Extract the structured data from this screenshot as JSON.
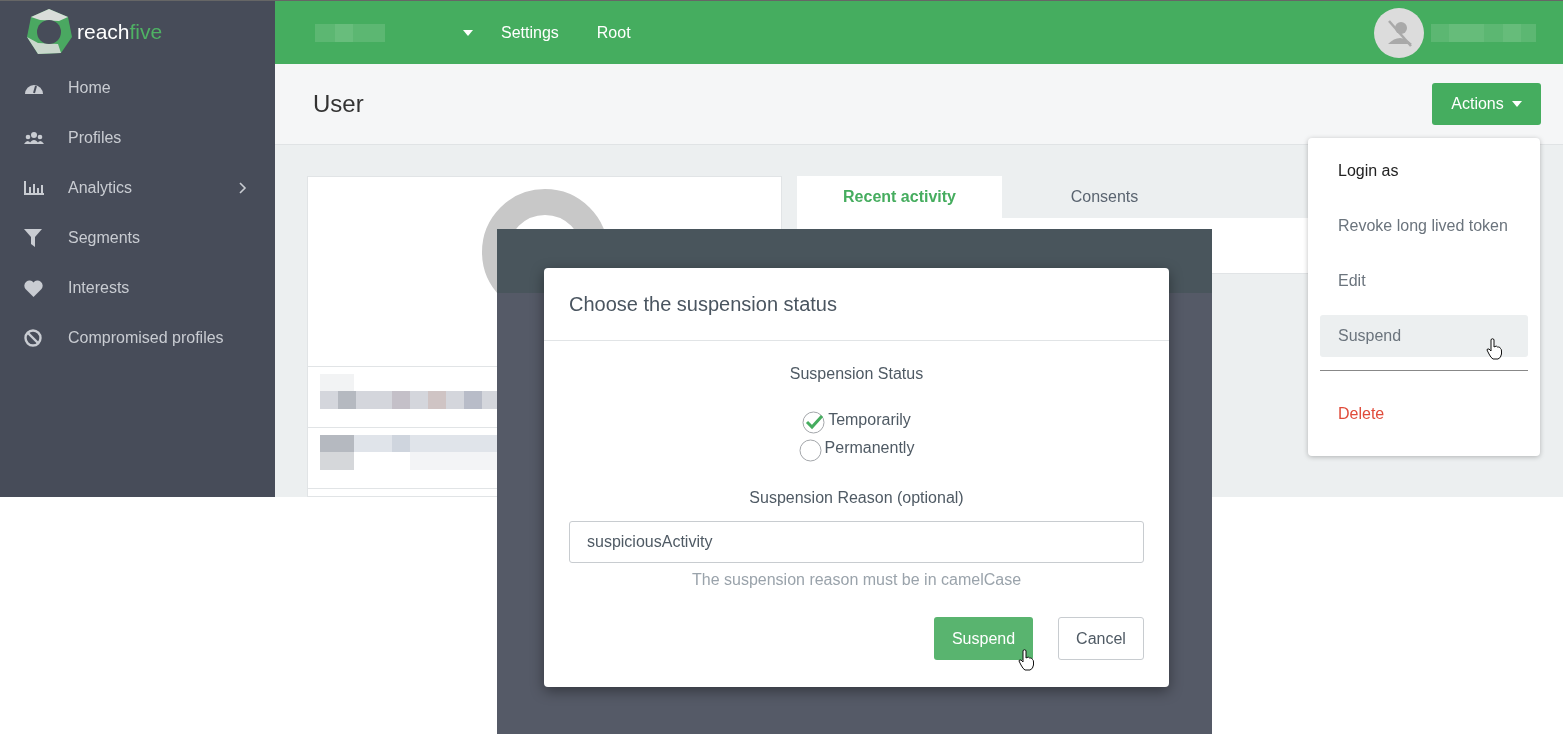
{
  "sidebar": {
    "logo": [
      "reach",
      "five"
    ],
    "items": [
      {
        "label": "Home",
        "expandable": false
      },
      {
        "label": "Profiles",
        "expandable": false
      },
      {
        "label": "Analytics",
        "expandable": true
      },
      {
        "label": "Segments",
        "expandable": false
      },
      {
        "label": "Interests",
        "expandable": false
      },
      {
        "label": "Compromised profiles",
        "expandable": false
      }
    ]
  },
  "topbar": {
    "links": [
      {
        "label": "Settings"
      },
      {
        "label": "Root"
      }
    ]
  },
  "page": {
    "title": "User",
    "actions_button": "Actions"
  },
  "actions_menu": [
    {
      "kind": "item",
      "label": "Login as",
      "highlighted": false
    },
    {
      "kind": "item",
      "label": "Revoke long lived token",
      "highlighted": false
    },
    {
      "kind": "item",
      "label": "Edit",
      "highlighted": false
    },
    {
      "kind": "item",
      "label": "Suspend",
      "highlighted": true
    },
    {
      "kind": "divider"
    },
    {
      "kind": "danger",
      "label": "Delete",
      "highlighted": false
    }
  ],
  "tabs": [
    {
      "label": "Recent activity",
      "selected": true
    },
    {
      "label": "Consents",
      "selected": false
    }
  ],
  "modal": {
    "title": "Choose the suspension status",
    "status_label": "Suspension Status",
    "options": [
      {
        "label": "Temporarily",
        "checked": true
      },
      {
        "label": "Permanently",
        "checked": false
      }
    ],
    "reason_label": "Suspension Reason (optional)",
    "reason_value": "suspiciousActivity",
    "hint": "The suspension reason must be in camelCase",
    "buttons": [
      {
        "label": "Suspend",
        "kind": "primary"
      },
      {
        "label": "Cancel",
        "kind": "secondary"
      }
    ]
  }
}
